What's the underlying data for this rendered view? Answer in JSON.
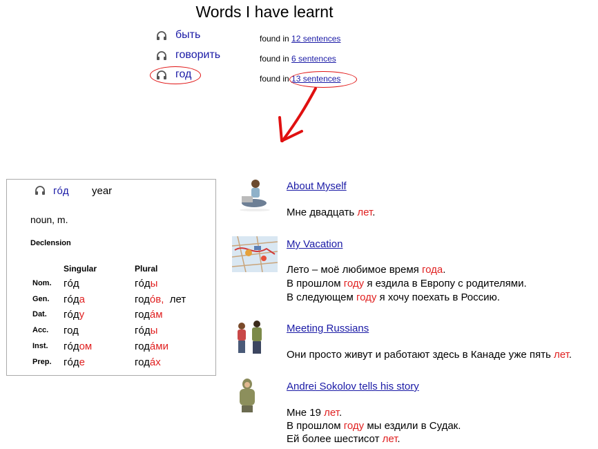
{
  "title": "Words I have learnt",
  "words": [
    {
      "word": "быть",
      "found_prefix": "found in",
      "found_link": "12 sentences"
    },
    {
      "word": "говорить",
      "found_prefix": "found in",
      "found_link": "6 sentences"
    },
    {
      "word": "год",
      "found_prefix": "found in",
      "found_link": "13 sentences"
    }
  ],
  "card": {
    "headword": "гóд",
    "translation": "year",
    "pos": "noun, m.",
    "declension_label": "Declension",
    "singular_label": "Singular",
    "plural_label": "Plural",
    "rows": [
      {
        "case": "Nom.",
        "sg_stem": "гóд",
        "sg_end": "",
        "pl_stem": "гóд",
        "pl_end": "ы",
        "pl_extra": ""
      },
      {
        "case": "Gen.",
        "sg_stem": "гóд",
        "sg_end": "а",
        "pl_stem": "год",
        "pl_end": "óв,",
        "pl_extra": "лет"
      },
      {
        "case": "Dat.",
        "sg_stem": "гóд",
        "sg_end": "у",
        "pl_stem": "год",
        "pl_end": "áм",
        "pl_extra": ""
      },
      {
        "case": "Acc.",
        "sg_stem": "год",
        "sg_end": "",
        "pl_stem": "гóд",
        "pl_end": "ы",
        "pl_extra": ""
      },
      {
        "case": "Inst.",
        "sg_stem": "гóд",
        "sg_end": "ом",
        "pl_stem": "год",
        "pl_end": "áми",
        "pl_extra": ""
      },
      {
        "case": "Prep.",
        "sg_stem": "гóд",
        "sg_end": "е",
        "pl_stem": "год",
        "pl_end": "áх",
        "pl_extra": ""
      }
    ]
  },
  "stories": [
    {
      "title": "About Myself",
      "thumb": "girl-sitting-with-laptop",
      "lines": [
        [
          "Мне двадцать ",
          "лет",
          "."
        ]
      ]
    },
    {
      "title": "My Vacation",
      "thumb": "europe-map",
      "lines": [
        [
          "Лето – моё любимое время ",
          "года",
          "."
        ],
        [
          "В прошлом ",
          "году",
          " я ездила в Европу с родителями."
        ],
        [
          "В следующем ",
          "году",
          " я хочу поехать в Россию."
        ]
      ]
    },
    {
      "title": "Meeting Russians",
      "thumb": "two-students",
      "lines": [
        [
          "Они просто живут и работают здесь в Канаде уже пять ",
          "лет",
          "."
        ]
      ]
    },
    {
      "title": "Andrei Sokolov tells his story",
      "thumb": "man-in-hoodie",
      "lines": [
        [
          "Мне 19 ",
          "лет",
          "."
        ],
        [
          "В прошлом ",
          "году",
          " мы ездили в Судак."
        ],
        [
          "Ей более шестисот ",
          "лет",
          "."
        ]
      ]
    }
  ],
  "colors": {
    "link": "#1a1aa6",
    "highlight": "#e02020",
    "annotation": "#e01010"
  }
}
